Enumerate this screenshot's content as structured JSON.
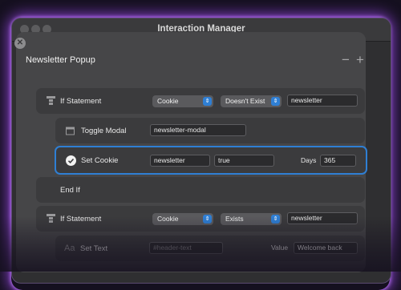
{
  "window": {
    "title": "Interaction Manager"
  },
  "panel": {
    "heading": "Newsletter Popup",
    "minus": "−",
    "plus": "+"
  },
  "rows": {
    "if1": {
      "label": "If Statement",
      "select1": "Cookie",
      "select2": "Doesn't Exist",
      "value": "newsletter"
    },
    "toggle": {
      "label": "Toggle Modal",
      "value": "newsletter-modal"
    },
    "setcookie": {
      "label": "Set Cookie",
      "name": "newsletter",
      "value": "true",
      "days_label": "Days",
      "days": "365"
    },
    "endif": {
      "label": "End If"
    },
    "if2": {
      "label": "If Statement",
      "select1": "Cookie",
      "select2": "Exists",
      "value": "newsletter"
    },
    "settext": {
      "icon_text": "Aa",
      "label": "Set Text",
      "target_placeholder": "#header-text",
      "value_label": "Value",
      "value": "Welcome back"
    }
  },
  "icons": {
    "close": "close-icon",
    "if": "if-statement-icon",
    "modal": "window-icon",
    "check": "checkmark-icon",
    "chevron": "chevron-updown-icon"
  },
  "colors": {
    "accent": "#2f7fd4",
    "glow": "#aa50ff"
  }
}
